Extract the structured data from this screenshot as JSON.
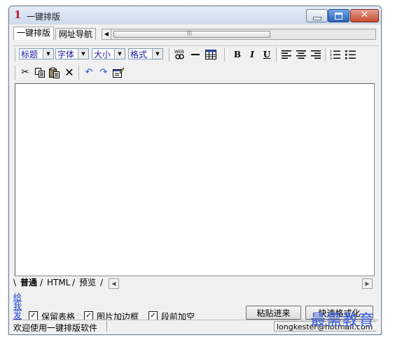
{
  "window": {
    "num": "1",
    "title": "一键排版"
  },
  "tabs": [
    "一键排版",
    "网址导航"
  ],
  "toolbar": {
    "title_sel": "标题",
    "font_sel": "字体",
    "size_sel": "大小",
    "format_sel": "格式",
    "bold": "B",
    "italic": "I",
    "underline": "U"
  },
  "mode_tabs": [
    "普通",
    "HTML",
    "预览"
  ],
  "sidebar_link": "给我发",
  "options": [
    {
      "label": "保留表格",
      "checked": true
    },
    {
      "label": "图片加边框",
      "checked": true
    },
    {
      "label": "段前加空",
      "checked": true
    }
  ],
  "buttons": {
    "paste": "粘贴进来",
    "format": "快速格式化"
  },
  "status": {
    "left": "欢迎使用一键排版软件",
    "right": "longkester@hotmail.com"
  },
  "watermark": "最需教育",
  "colors": {
    "title_number": "#c0172b",
    "link": "#1a3fd0",
    "watermark": "#3b5fe0"
  }
}
